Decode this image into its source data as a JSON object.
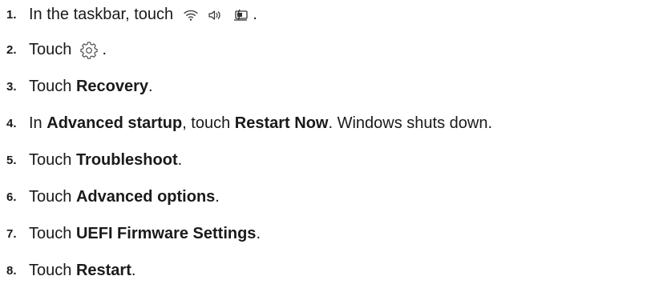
{
  "steps": [
    {
      "number": "1.",
      "text_before": "In the taskbar, touch",
      "icons": [
        "wifi-icon",
        "speaker-icon",
        "battery-icon"
      ],
      "text_after": "."
    },
    {
      "number": "2.",
      "text_before": "Touch",
      "icons": [
        "settings-gear-icon"
      ],
      "text_after": "."
    },
    {
      "number": "3.",
      "text_before": "Touch ",
      "bold": "Recovery",
      "text_after": "."
    },
    {
      "number": "4.",
      "text_before": "In ",
      "bold": "Advanced startup",
      "text_middle": ", touch ",
      "bold2": "Restart Now",
      "text_after": ". Windows shuts down."
    },
    {
      "number": "5.",
      "text_before": "Touch ",
      "bold": "Troubleshoot",
      "text_after": "."
    },
    {
      "number": "6.",
      "text_before": "Touch ",
      "bold": "Advanced options",
      "text_after": "."
    },
    {
      "number": "7.",
      "text_before": "Touch ",
      "bold": "UEFI Firmware Settings",
      "text_after": "."
    },
    {
      "number": "8.",
      "text_before": "Touch ",
      "bold": "Restart",
      "text_after": "."
    }
  ]
}
